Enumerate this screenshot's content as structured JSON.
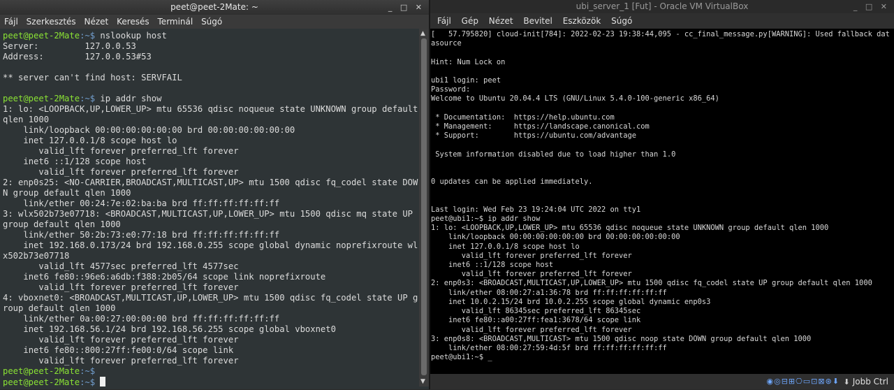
{
  "terminal": {
    "title": "peet@peet-2Mate: ~",
    "window_controls": "_ □ ✕",
    "menu": [
      "Fájl",
      "Szerkesztés",
      "Nézet",
      "Keresés",
      "Terminál",
      "Súgó"
    ],
    "prompt_user": "peet@peet-2Mate",
    "prompt_path": ":~$",
    "lines": [
      {
        "type": "prompt",
        "cmd": " nslookup host"
      },
      {
        "type": "out",
        "text": "Server:\t\t127.0.0.53"
      },
      {
        "type": "out",
        "text": "Address:\t127.0.0.53#53"
      },
      {
        "type": "out",
        "text": ""
      },
      {
        "type": "out",
        "text": "** server can't find host: SERVFAIL"
      },
      {
        "type": "out",
        "text": ""
      },
      {
        "type": "prompt",
        "cmd": " ip addr show"
      },
      {
        "type": "out",
        "text": "1: lo: <LOOPBACK,UP,LOWER_UP> mtu 65536 qdisc noqueue state UNKNOWN group default qlen 1000"
      },
      {
        "type": "out",
        "text": "    link/loopback 00:00:00:00:00:00 brd 00:00:00:00:00:00"
      },
      {
        "type": "out",
        "text": "    inet 127.0.0.1/8 scope host lo"
      },
      {
        "type": "out",
        "text": "       valid_lft forever preferred_lft forever"
      },
      {
        "type": "out",
        "text": "    inet6 ::1/128 scope host"
      },
      {
        "type": "out",
        "text": "       valid_lft forever preferred_lft forever"
      },
      {
        "type": "out",
        "text": "2: enp0s25: <NO-CARRIER,BROADCAST,MULTICAST,UP> mtu 1500 qdisc fq_codel state DOWN group default qlen 1000"
      },
      {
        "type": "out",
        "text": "    link/ether 00:24:7e:02:ba:ba brd ff:ff:ff:ff:ff:ff"
      },
      {
        "type": "out",
        "text": "3: wlx502b73e07718: <BROADCAST,MULTICAST,UP,LOWER_UP> mtu 1500 qdisc mq state UP group default qlen 1000"
      },
      {
        "type": "out",
        "text": "    link/ether 50:2b:73:e0:77:18 brd ff:ff:ff:ff:ff:ff"
      },
      {
        "type": "out",
        "text": "    inet 192.168.0.173/24 brd 192.168.0.255 scope global dynamic noprefixroute wlx502b73e07718"
      },
      {
        "type": "out",
        "text": "       valid_lft 4577sec preferred_lft 4577sec"
      },
      {
        "type": "out",
        "text": "    inet6 fe80::96e6:a6db:f388:2b05/64 scope link noprefixroute"
      },
      {
        "type": "out",
        "text": "       valid_lft forever preferred_lft forever"
      },
      {
        "type": "out",
        "text": "4: vboxnet0: <BROADCAST,MULTICAST,UP,LOWER_UP> mtu 1500 qdisc fq_codel state UP group default qlen 1000"
      },
      {
        "type": "out",
        "text": "    link/ether 0a:00:27:00:00:00 brd ff:ff:ff:ff:ff:ff"
      },
      {
        "type": "out",
        "text": "    inet 192.168.56.1/24 brd 192.168.56.255 scope global vboxnet0"
      },
      {
        "type": "out",
        "text": "       valid_lft forever preferred_lft forever"
      },
      {
        "type": "out",
        "text": "    inet6 fe80::800:27ff:fe00:0/64 scope link"
      },
      {
        "type": "out",
        "text": "       valid_lft forever preferred_lft forever"
      },
      {
        "type": "prompt",
        "cmd": ""
      },
      {
        "type": "prompt_cursor",
        "cmd": " "
      }
    ]
  },
  "vbox": {
    "title": "ubi_server_1 [Fut] - Oracle VM VirtualBox",
    "window_controls": "_ □ ✕",
    "menu": [
      "Fájl",
      "Gép",
      "Nézet",
      "Bevitel",
      "Eszközök",
      "Súgó"
    ],
    "console": "[   57.795820] cloud-init[784]: 2022-02-23 19:38:44,095 - cc_final_message.py[WARNING]: Used fallback datasource\n\nHint: Num Lock on\n\nubi1 login: peet\nPassword:\nWelcome to Ubuntu 20.04.4 LTS (GNU/Linux 5.4.0-100-generic x86_64)\n\n * Documentation:  https://help.ubuntu.com\n * Management:     https://landscape.canonical.com\n * Support:        https://ubuntu.com/advantage\n\n System information disabled due to load higher than 1.0\n\n\n0 updates can be applied immediately.\n\n\nLast login: Wed Feb 23 19:24:04 UTC 2022 on tty1\npeet@ubi1:~$ ip addr show\n1: lo: <LOOPBACK,UP,LOWER_UP> mtu 65536 qdisc noqueue state UNKNOWN group default qlen 1000\n    link/loopback 00:00:00:00:00:00 brd 00:00:00:00:00:00\n    inet 127.0.0.1/8 scope host lo\n       valid_lft forever preferred_lft forever\n    inet6 ::1/128 scope host\n       valid_lft forever preferred_lft forever\n2: enp0s3: <BROADCAST,MULTICAST,UP,LOWER_UP> mtu 1500 qdisc fq_codel state UP group default qlen 1000\n    link/ether 08:00:27:a1:36:78 brd ff:ff:ff:ff:ff:ff\n    inet 10.0.2.15/24 brd 10.0.2.255 scope global dynamic enp0s3\n       valid_lft 86345sec preferred_lft 86345sec\n    inet6 fe80::a00:27ff:fea1:3678/64 scope link\n       valid_lft forever preferred_lft forever\n3: enp0s8: <BROADCAST,MULTICAST> mtu 1500 qdisc noop state DOWN group default qlen 1000\n    link/ether 08:00:27:59:4d:5f brd ff:ff:ff:ff:ff:ff\npeet@ubi1:~$ _",
    "status_icons": "◉◎⊟⊞⎔▭⊡⊠⊛⬇",
    "host_key": "Jobb Ctrl"
  },
  "colors": {
    "prompt_user": "#8ae234",
    "prompt_path": "#729fcf",
    "terminal_bg": "#2e3436"
  }
}
